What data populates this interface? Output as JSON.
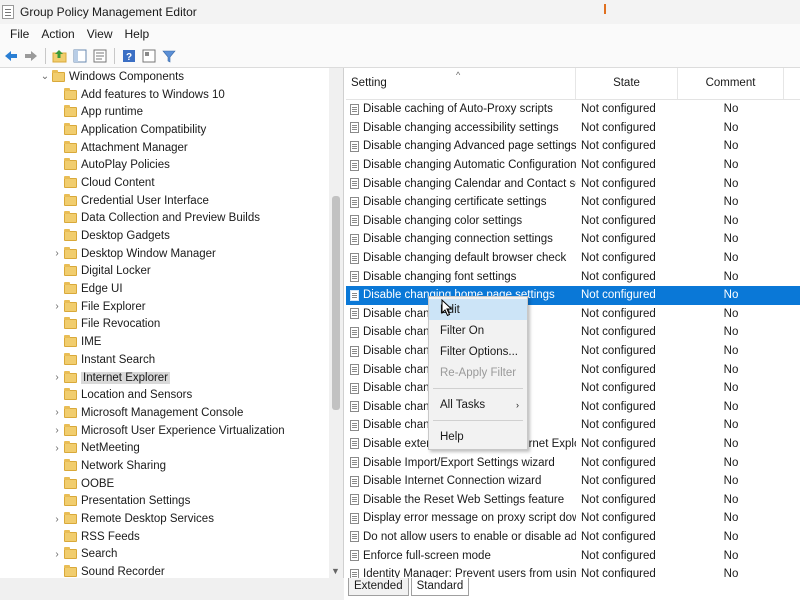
{
  "window": {
    "title": "Group Policy Management Editor"
  },
  "menubar": {
    "items": [
      "File",
      "Action",
      "View",
      "Help"
    ]
  },
  "toolbar": {
    "icons": [
      "back-arrow-icon",
      "forward-arrow-icon",
      "up-folder-icon",
      "show-hide-tree-icon",
      "properties-icon",
      "help-icon",
      "view-icon",
      "filter-icon"
    ]
  },
  "tree": {
    "root": {
      "label": "Windows Components",
      "expanded": true
    },
    "items": [
      {
        "label": "Add features to Windows 10",
        "expandable": false
      },
      {
        "label": "App runtime",
        "expandable": false
      },
      {
        "label": "Application Compatibility",
        "expandable": false
      },
      {
        "label": "Attachment Manager",
        "expandable": false
      },
      {
        "label": "AutoPlay Policies",
        "expandable": false
      },
      {
        "label": "Cloud Content",
        "expandable": false
      },
      {
        "label": "Credential User Interface",
        "expandable": false
      },
      {
        "label": "Data Collection and Preview Builds",
        "expandable": false
      },
      {
        "label": "Desktop Gadgets",
        "expandable": false
      },
      {
        "label": "Desktop Window Manager",
        "expandable": true
      },
      {
        "label": "Digital Locker",
        "expandable": false
      },
      {
        "label": "Edge UI",
        "expandable": false
      },
      {
        "label": "File Explorer",
        "expandable": true
      },
      {
        "label": "File Revocation",
        "expandable": false
      },
      {
        "label": "IME",
        "expandable": false
      },
      {
        "label": "Instant Search",
        "expandable": false
      },
      {
        "label": "Internet Explorer",
        "expandable": true,
        "selected": true
      },
      {
        "label": "Location and Sensors",
        "expandable": false
      },
      {
        "label": "Microsoft Management Console",
        "expandable": true
      },
      {
        "label": "Microsoft User Experience Virtualization",
        "expandable": true
      },
      {
        "label": "NetMeeting",
        "expandable": true
      },
      {
        "label": "Network Sharing",
        "expandable": false
      },
      {
        "label": "OOBE",
        "expandable": false
      },
      {
        "label": "Presentation Settings",
        "expandable": false
      },
      {
        "label": "Remote Desktop Services",
        "expandable": true
      },
      {
        "label": "RSS Feeds",
        "expandable": false
      },
      {
        "label": "Search",
        "expandable": true
      },
      {
        "label": "Sound Recorder",
        "expandable": false
      }
    ]
  },
  "list": {
    "columns": {
      "setting": "Setting",
      "state": "State",
      "comment": "Comment"
    },
    "rows": [
      {
        "setting": "Disable caching of Auto-Proxy scripts",
        "state": "Not configured",
        "comment": "No"
      },
      {
        "setting": "Disable changing accessibility settings",
        "state": "Not configured",
        "comment": "No"
      },
      {
        "setting": "Disable changing Advanced page settings",
        "state": "Not configured",
        "comment": "No"
      },
      {
        "setting": "Disable changing Automatic Configuration settings",
        "state": "Not configured",
        "comment": "No"
      },
      {
        "setting": "Disable changing Calendar and Contact settings",
        "state": "Not configured",
        "comment": "No"
      },
      {
        "setting": "Disable changing certificate settings",
        "state": "Not configured",
        "comment": "No"
      },
      {
        "setting": "Disable changing color settings",
        "state": "Not configured",
        "comment": "No"
      },
      {
        "setting": "Disable changing connection settings",
        "state": "Not configured",
        "comment": "No"
      },
      {
        "setting": "Disable changing default browser check",
        "state": "Not configured",
        "comment": "No"
      },
      {
        "setting": "Disable changing font settings",
        "state": "Not configured",
        "comment": "No"
      },
      {
        "setting": "Disable changing home page settings",
        "state": "Not configured",
        "comment": "No",
        "selected": true
      },
      {
        "setting": "Disable changing",
        "state": "Not configured",
        "comment": "No"
      },
      {
        "setting": "Disable changing",
        "state": "Not configured",
        "comment": "No"
      },
      {
        "setting": "Disable changing",
        "state": "Not configured",
        "comment": "No"
      },
      {
        "setting": "Disable changing",
        "state": "Not configured",
        "comment": "No"
      },
      {
        "setting": "Disable changing",
        "state": "Not configured",
        "comment": "No"
      },
      {
        "setting": "Disable changing",
        "state": "Not configured",
        "comment": "No"
      },
      {
        "setting": "Disable changing",
        "state": "Not configured",
        "comment": "No"
      },
      {
        "setting": "Disable external branding of Internet Explorer",
        "state": "Not configured",
        "comment": "No"
      },
      {
        "setting": "Disable Import/Export Settings wizard",
        "state": "Not configured",
        "comment": "No"
      },
      {
        "setting": "Disable Internet Connection wizard",
        "state": "Not configured",
        "comment": "No"
      },
      {
        "setting": "Disable the Reset Web Settings feature",
        "state": "Not configured",
        "comment": "No"
      },
      {
        "setting": "Display error message on proxy script download failure",
        "state": "Not configured",
        "comment": "No"
      },
      {
        "setting": "Do not allow users to enable or disable add-ons",
        "state": "Not configured",
        "comment": "No"
      },
      {
        "setting": "Enforce full-screen mode",
        "state": "Not configured",
        "comment": "No"
      },
      {
        "setting": "Identity Manager: Prevent users from using Identities",
        "state": "Not configured",
        "comment": "No"
      }
    ]
  },
  "context_menu": {
    "items": [
      {
        "label": "Edit",
        "hover": true
      },
      {
        "label": "Filter On"
      },
      {
        "label": "Filter Options..."
      },
      {
        "label": "Re-Apply Filter",
        "disabled": true
      },
      {
        "separator": true
      },
      {
        "label": "All Tasks",
        "submenu": true
      },
      {
        "separator": true
      },
      {
        "label": "Help"
      }
    ]
  },
  "tabs": [
    "Extended",
    "Standard"
  ],
  "active_tab": "Standard",
  "colors": {
    "selection": "#0a78d7",
    "hover": "#cce4f7",
    "folder": "#f1cd6e"
  }
}
